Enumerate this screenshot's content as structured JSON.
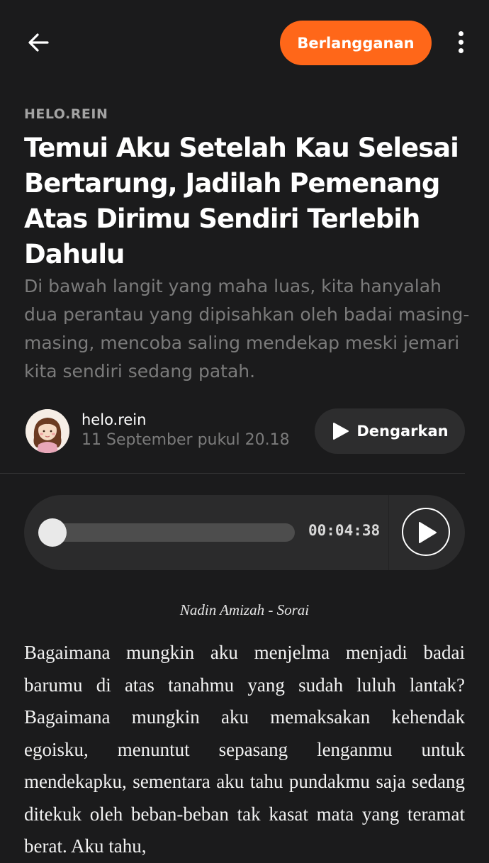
{
  "header": {
    "subscribe_label": "Berlangganan"
  },
  "post": {
    "publication": "HELO.REIN",
    "title": "Temui Aku Setelah Kau Selesai Bertarung, Jadilah Pemenang Atas Dirimu Sendiri Terlebih Dahulu",
    "subtitle": "Di bawah langit yang maha luas, kita hanyalah dua perantau yang dipisahkan oleh badai masing-masing, mencoba saling mendekap meski jemari kita sendiri sedang patah.",
    "author": "helo.rein",
    "date": "11 September pukul 20.18",
    "listen_label": "Dengarkan"
  },
  "audio": {
    "timestamp": "00:04:38",
    "progress": 0
  },
  "caption": "Nadin Amizah - Sorai",
  "body": "Bagaimana mungkin aku menjelma menjadi badai barumu di atas tanahmu yang sudah luluh lantak? Bagaimana mungkin aku memaksakan kehendak egoisku, menuntut sepasang lenganmu untuk mendekapku, sementara aku tahu pundakmu saja sedang ditekuk oleh beban-beban tak kasat mata yang teramat berat. Aku tahu,",
  "icons": {
    "back": "arrow-left-icon",
    "more": "more-vertical-icon",
    "play": "play-icon",
    "accent_color": "#ff6719"
  }
}
